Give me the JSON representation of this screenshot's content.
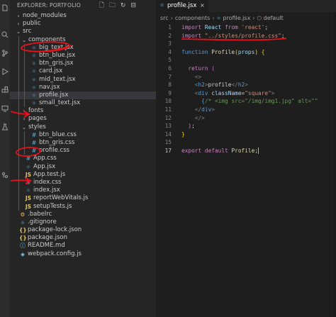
{
  "explorer": {
    "title": "EXPLORER: PORTFOLIO"
  },
  "tree": [
    {
      "label": "node_modules",
      "chevron": "›",
      "indent": 0,
      "icon": "",
      "iconColor": ""
    },
    {
      "label": "public",
      "chevron": "›",
      "indent": 0,
      "icon": "",
      "iconColor": ""
    },
    {
      "label": "src",
      "chevron": "⌄",
      "indent": 0,
      "icon": "",
      "iconColor": ""
    },
    {
      "label": "components",
      "chevron": "⌄",
      "indent": 1,
      "icon": "",
      "iconColor": ""
    },
    {
      "label": "big_text.jsx",
      "chevron": "",
      "indent": 2,
      "icon": "⚛",
      "iconColor": "#519aba"
    },
    {
      "label": "btn_blue.jsx",
      "chevron": "",
      "indent": 2,
      "icon": "⚛",
      "iconColor": "#519aba"
    },
    {
      "label": "btn_gris.jsx",
      "chevron": "",
      "indent": 2,
      "icon": "⚛",
      "iconColor": "#519aba"
    },
    {
      "label": "card.jsx",
      "chevron": "",
      "indent": 2,
      "icon": "⚛",
      "iconColor": "#519aba"
    },
    {
      "label": "mid_text.jsx",
      "chevron": "",
      "indent": 2,
      "icon": "⚛",
      "iconColor": "#519aba"
    },
    {
      "label": "nav.jsx",
      "chevron": "",
      "indent": 2,
      "icon": "⚛",
      "iconColor": "#519aba"
    },
    {
      "label": "profile.jsx",
      "chevron": "",
      "indent": 2,
      "icon": "⚛",
      "iconColor": "#519aba",
      "selected": true
    },
    {
      "label": "small_text.jsx",
      "chevron": "",
      "indent": 2,
      "icon": "⚛",
      "iconColor": "#519aba"
    },
    {
      "label": "fonts",
      "chevron": "›",
      "indent": 1,
      "icon": "",
      "iconColor": ""
    },
    {
      "label": "pages",
      "chevron": "›",
      "indent": 1,
      "icon": "",
      "iconColor": ""
    },
    {
      "label": "styles",
      "chevron": "⌄",
      "indent": 1,
      "icon": "",
      "iconColor": ""
    },
    {
      "label": "btn_blue.css",
      "chevron": "",
      "indent": 2,
      "icon": "#",
      "iconColor": "#519aba"
    },
    {
      "label": "btn_gris.css",
      "chevron": "",
      "indent": 2,
      "icon": "#",
      "iconColor": "#519aba"
    },
    {
      "label": "profile.css",
      "chevron": "",
      "indent": 2,
      "icon": "#",
      "iconColor": "#519aba"
    },
    {
      "label": "App.css",
      "chevron": "",
      "indent": 1,
      "icon": "#",
      "iconColor": "#519aba"
    },
    {
      "label": "App.jsx",
      "chevron": "",
      "indent": 1,
      "icon": "⚛",
      "iconColor": "#519aba"
    },
    {
      "label": "App.test.js",
      "chevron": "",
      "indent": 1,
      "icon": "JS",
      "iconColor": "#e8c35a"
    },
    {
      "label": "index.css",
      "chevron": "",
      "indent": 1,
      "icon": "#",
      "iconColor": "#519aba"
    },
    {
      "label": "index.jsx",
      "chevron": "",
      "indent": 1,
      "icon": "⚛",
      "iconColor": "#519aba"
    },
    {
      "label": "reportWebVitals.js",
      "chevron": "",
      "indent": 1,
      "icon": "JS",
      "iconColor": "#e8c35a"
    },
    {
      "label": "setupTests.js",
      "chevron": "",
      "indent": 1,
      "icon": "JS",
      "iconColor": "#e8c35a"
    },
    {
      "label": ".babelrc",
      "chevron": "",
      "indent": 0,
      "icon": "⚙",
      "iconColor": "#e8c35a"
    },
    {
      "label": ".gitignore",
      "chevron": "",
      "indent": 0,
      "icon": "◆",
      "iconColor": "#41535b"
    },
    {
      "label": "package-lock.json",
      "chevron": "",
      "indent": 0,
      "icon": "{}",
      "iconColor": "#e8c35a"
    },
    {
      "label": "package.json",
      "chevron": "",
      "indent": 0,
      "icon": "{}",
      "iconColor": "#e8c35a"
    },
    {
      "label": "README.md",
      "chevron": "",
      "indent": 0,
      "icon": "ⓘ",
      "iconColor": "#519aba"
    },
    {
      "label": "webpack.config.js",
      "chevron": "",
      "indent": 0,
      "icon": "◈",
      "iconColor": "#8dd6f9"
    }
  ],
  "tab": {
    "label": "profile.jsx",
    "close": "×"
  },
  "breadcrumb": {
    "parts": [
      "src",
      "components",
      "profile.jsx",
      "default"
    ]
  },
  "code": [
    {
      "n": "1",
      "tokens": [
        [
          "import",
          "kw"
        ],
        [
          " ",
          ""
        ],
        [
          "React",
          "var"
        ],
        [
          " ",
          ""
        ],
        [
          "from",
          "kw"
        ],
        [
          " ",
          ""
        ],
        [
          "'react'",
          "str"
        ],
        [
          ";",
          "pun"
        ]
      ]
    },
    {
      "n": "2",
      "tokens": [
        [
          "import",
          "kw"
        ],
        [
          " ",
          ""
        ],
        [
          "\"../styles/profile.css\"",
          "str"
        ],
        [
          ";",
          "pun"
        ]
      ]
    },
    {
      "n": "3",
      "tokens": []
    },
    {
      "n": "4",
      "tokens": [
        [
          "function",
          "sto"
        ],
        [
          " ",
          ""
        ],
        [
          "Profile",
          "fn"
        ],
        [
          "(",
          "br1"
        ],
        [
          "props",
          "var"
        ],
        [
          ")",
          "br1"
        ],
        [
          " ",
          ""
        ],
        [
          "{",
          "br1"
        ]
      ]
    },
    {
      "n": "5",
      "tokens": []
    },
    {
      "n": "6",
      "tokens": [
        [
          "  ",
          ""
        ],
        [
          "return",
          "kw"
        ],
        [
          " ",
          ""
        ],
        [
          "(",
          "br2"
        ]
      ]
    },
    {
      "n": "7",
      "tokens": [
        [
          "    ",
          ""
        ],
        [
          "<>",
          "tag"
        ]
      ]
    },
    {
      "n": "8",
      "tokens": [
        [
          "    ",
          ""
        ],
        [
          "<",
          "tag"
        ],
        [
          "h2",
          "tagn"
        ],
        [
          ">",
          "tag"
        ],
        [
          "profile",
          "pun"
        ],
        [
          "</",
          "tag"
        ],
        [
          "h2",
          "tagn"
        ],
        [
          ">",
          "tag"
        ]
      ]
    },
    {
      "n": "9",
      "tokens": [
        [
          "    ",
          ""
        ],
        [
          "<",
          "tag"
        ],
        [
          "div",
          "tagn"
        ],
        [
          " ",
          ""
        ],
        [
          "className",
          "var"
        ],
        [
          "=",
          "pun"
        ],
        [
          "\"square\"",
          "str"
        ],
        [
          ">",
          "tag"
        ]
      ]
    },
    {
      "n": "10",
      "tokens": [
        [
          "      ",
          ""
        ],
        [
          "{",
          "sto"
        ],
        [
          "/* <img src=\"/img/img1.jpg\" alt=\"\"",
          "com"
        ]
      ]
    },
    {
      "n": "11",
      "tokens": [
        [
          "    ",
          ""
        ],
        [
          "</",
          "tag"
        ],
        [
          "div",
          "tagn"
        ],
        [
          ">",
          "tag"
        ]
      ]
    },
    {
      "n": "12",
      "tokens": [
        [
          "    ",
          ""
        ],
        [
          "</>",
          "tag"
        ]
      ]
    },
    {
      "n": "13",
      "tokens": [
        [
          "  ",
          ""
        ],
        [
          ")",
          "br2"
        ],
        [
          ";",
          "pun"
        ]
      ]
    },
    {
      "n": "14",
      "tokens": [
        [
          "}",
          "br1"
        ]
      ]
    },
    {
      "n": "15",
      "tokens": []
    },
    {
      "n": "17",
      "tokens": [
        [
          "export",
          "kw"
        ],
        [
          " ",
          ""
        ],
        [
          "default",
          "kw"
        ],
        [
          " ",
          ""
        ],
        [
          "Profile",
          "fn"
        ],
        [
          ";",
          "pun"
        ]
      ],
      "active": true,
      "cursor": true
    }
  ],
  "colors": {
    "annotation_red": "#e8111b",
    "selection": "#37373d",
    "editor_bg": "#1e1e1e",
    "sidebar_bg": "#252526"
  }
}
